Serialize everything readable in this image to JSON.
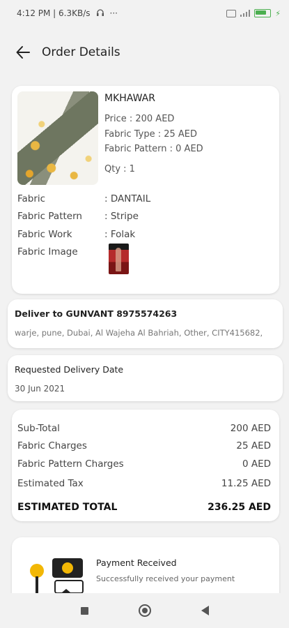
{
  "status_bar": {
    "time_and_speed": "4:12 PM | 6.3KB/s",
    "more": "···"
  },
  "header": {
    "title": "Order Details",
    "back_icon": "arrow-left-icon"
  },
  "product": {
    "name": "MKHAWAR",
    "price": "Price : 200 AED",
    "fabric_type": "Fabric Type : 25 AED",
    "fabric_pattern": "Fabric Pattern : 0 AED",
    "qty": "Qty : 1",
    "details": [
      {
        "label": "Fabric",
        "value": ": DANTAIL"
      },
      {
        "label": "Fabric Pattern",
        "value": ": Stripe"
      },
      {
        "label": "Fabric Work",
        "value": ": Folak"
      },
      {
        "label": "Fabric Image",
        "value": ""
      }
    ]
  },
  "delivery": {
    "title": "Deliver to GUNVANT 8975574263",
    "address": "warje, pune, Dubai, Al Wajeha Al Bahriah, Other, CITY415682,"
  },
  "requested_date": {
    "title": "Requested Delivery Date",
    "date": "30 Jun 2021"
  },
  "summary": {
    "rows": [
      {
        "label": "Sub-Total",
        "value": "200 AED"
      },
      {
        "label": "Fabric Charges",
        "value": "25 AED"
      },
      {
        "label": "Fabric Pattern Charges",
        "value": "0 AED"
      },
      {
        "label": "Estimated Tax",
        "value": "11.25 AED"
      }
    ],
    "total_label": "ESTIMATED TOTAL",
    "total_value": "236.25 AED"
  },
  "payment": {
    "title": "Payment Received",
    "subtitle": "Successfully received your payment"
  },
  "colors": {
    "background": "#f2f2f2",
    "card": "#ffffff",
    "battery": "#4caf50",
    "accent_yellow": "#f2b705"
  }
}
